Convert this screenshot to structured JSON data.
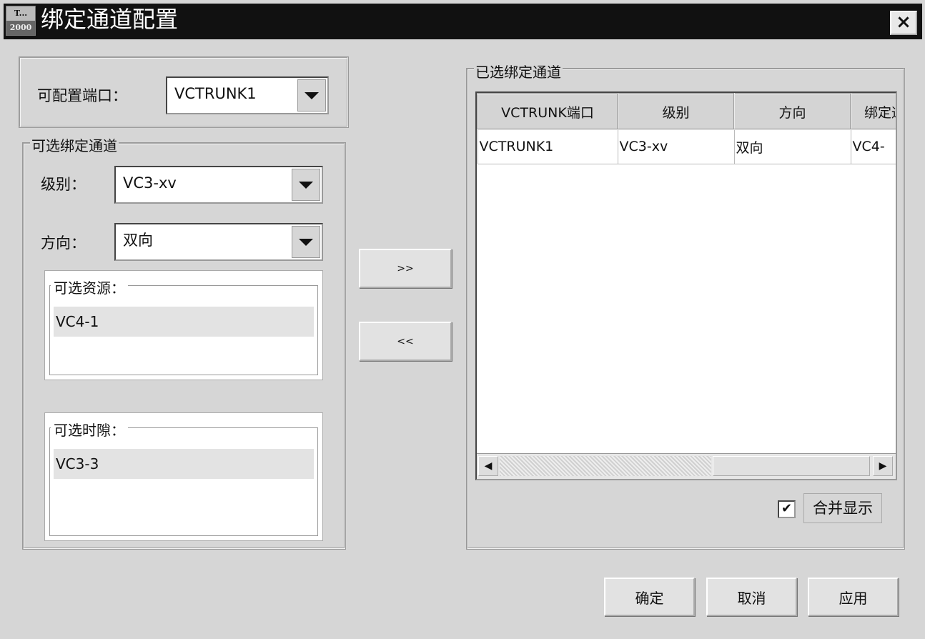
{
  "window": {
    "title": "绑定通道配置",
    "logo_top": "T...",
    "logo_bottom": "2000",
    "close_label": "×"
  },
  "port": {
    "label": "可配置端口：",
    "value": "VCTRUNK1"
  },
  "available": {
    "group_label": "可选绑定通道",
    "level_label": "级别：",
    "level_value": "VC3-xv",
    "direction_label": "方向：",
    "direction_value": "双向",
    "resources": {
      "title": "可选资源：",
      "items": [
        "VC4-1"
      ]
    },
    "timeslots": {
      "title": "可选时隙：",
      "items": [
        "VC3-3"
      ]
    }
  },
  "transfer": {
    "add_label": ">>",
    "remove_label": "<<"
  },
  "selected": {
    "group_label": "已选绑定通道",
    "columns": [
      "VCTRUNK端口",
      "级别",
      "方向",
      "绑定通道"
    ],
    "rows": [
      [
        "VCTRUNK1",
        "VC3-xv",
        "双向",
        "VC4-"
      ]
    ],
    "merge_display_label": "合并显示",
    "merge_display_checked": true
  },
  "footer": {
    "ok": "确定",
    "cancel": "取消",
    "apply": "应用"
  }
}
